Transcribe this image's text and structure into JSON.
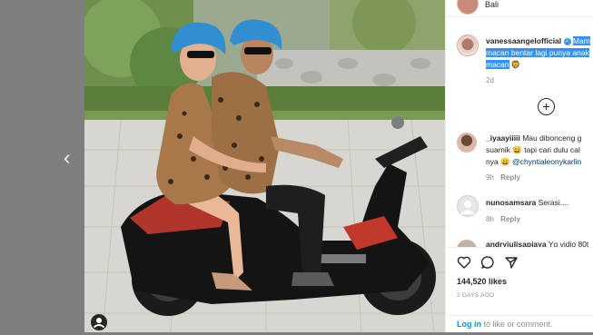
{
  "post": {
    "location": "Bali",
    "caption": {
      "username": "vanessaangelofficial",
      "highlighted_text": "Mam macan bentar lagi punya anak macan",
      "emoji": "🦁",
      "time": "2d"
    },
    "load_more_symbol": "+",
    "comments": [
      {
        "username": "_iyaayiiiii",
        "text_line1": "Mau dibonceng g",
        "text_line2": "suamik",
        "text_line2b": "tapi cari dulu cal",
        "text_line3": "nya",
        "mention": "@chyntialeonykarlin",
        "time": "9h",
        "reply_label": "Reply"
      },
      {
        "username": "nunosamsara",
        "text_line1": "Serasi....",
        "time": "8h",
        "reply_label": "Reply"
      },
      {
        "username": "andryiulisapiaya",
        "text_line1": "Yg vidio 80t"
      }
    ],
    "likes": "144,520 likes",
    "date": "2 DAYS AGO",
    "login_link": "Log in",
    "login_text": "to like or comment.",
    "prev_arrow": "‹"
  },
  "icons": {
    "heart": "heart-icon",
    "comment": "comment-icon",
    "share": "share-icon",
    "add": "plus-circle-icon",
    "user_tag": "user-tag-icon",
    "chevron_left": "chevron-left-icon",
    "verified": "verified-badge-icon"
  },
  "colors": {
    "highlight": "#3390ff",
    "link": "#0095f6",
    "verified": "#3897f0",
    "helmet": "#2f8fd0"
  }
}
